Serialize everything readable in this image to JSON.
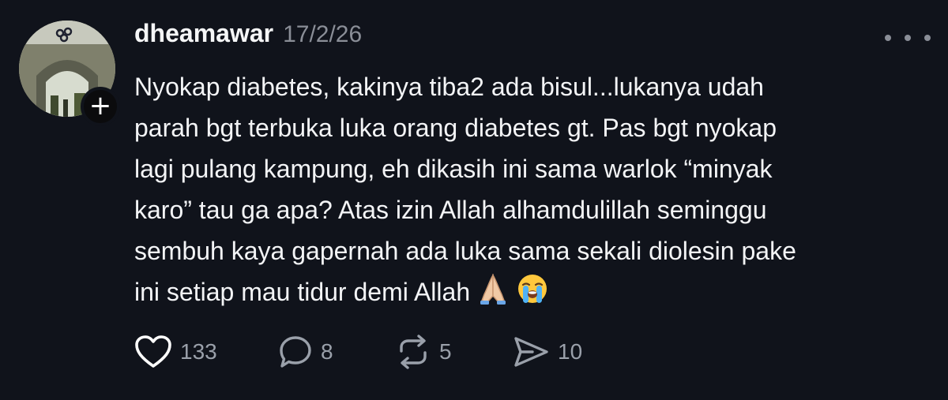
{
  "post": {
    "username": "dheamawar",
    "date": "17/2/26",
    "lines": [
      "Nyokap diabetes, kakinya tiba2 ada bisul...lukanya udah",
      "parah bgt terbuka luka orang diabetes gt. Pas bgt nyokap",
      "lagi pulang kampung, eh dikasih ini sama warlok “minyak",
      "karo” tau ga apa? Atas izin Allah alhamdulillah seminggu",
      "sembuh kaya gapernah ada luka sama sekali diolesin pake",
      "ini setiap mau tidur demi Allah"
    ],
    "emojis": [
      "folded-hands-icon",
      "loudly-crying-face-icon"
    ],
    "follow_symbol": "+"
  },
  "actions": {
    "likes": "133",
    "replies": "8",
    "reposts": "5",
    "shares": "10"
  },
  "colors": {
    "background": "#10131b",
    "text": "#f3f4f6",
    "muted": "#8a8e97"
  }
}
